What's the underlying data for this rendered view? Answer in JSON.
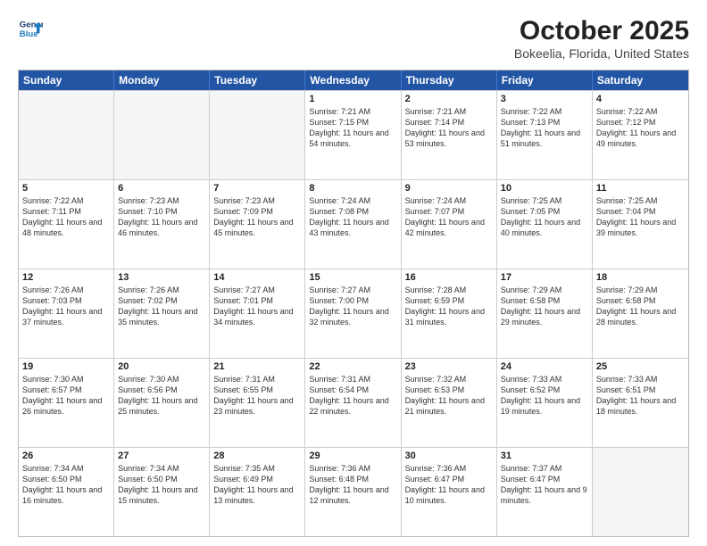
{
  "header": {
    "logo_line1": "General",
    "logo_line2": "Blue",
    "title": "October 2025",
    "subtitle": "Bokeelia, Florida, United States"
  },
  "weekdays": [
    "Sunday",
    "Monday",
    "Tuesday",
    "Wednesday",
    "Thursday",
    "Friday",
    "Saturday"
  ],
  "weeks": [
    [
      {
        "day": "",
        "empty": true
      },
      {
        "day": "",
        "empty": true
      },
      {
        "day": "",
        "empty": true
      },
      {
        "day": "1",
        "sunrise": "7:21 AM",
        "sunset": "7:15 PM",
        "daylight": "11 hours and 54 minutes."
      },
      {
        "day": "2",
        "sunrise": "7:21 AM",
        "sunset": "7:14 PM",
        "daylight": "11 hours and 53 minutes."
      },
      {
        "day": "3",
        "sunrise": "7:22 AM",
        "sunset": "7:13 PM",
        "daylight": "11 hours and 51 minutes."
      },
      {
        "day": "4",
        "sunrise": "7:22 AM",
        "sunset": "7:12 PM",
        "daylight": "11 hours and 49 minutes."
      }
    ],
    [
      {
        "day": "5",
        "sunrise": "7:22 AM",
        "sunset": "7:11 PM",
        "daylight": "11 hours and 48 minutes."
      },
      {
        "day": "6",
        "sunrise": "7:23 AM",
        "sunset": "7:10 PM",
        "daylight": "11 hours and 46 minutes."
      },
      {
        "day": "7",
        "sunrise": "7:23 AM",
        "sunset": "7:09 PM",
        "daylight": "11 hours and 45 minutes."
      },
      {
        "day": "8",
        "sunrise": "7:24 AM",
        "sunset": "7:08 PM",
        "daylight": "11 hours and 43 minutes."
      },
      {
        "day": "9",
        "sunrise": "7:24 AM",
        "sunset": "7:07 PM",
        "daylight": "11 hours and 42 minutes."
      },
      {
        "day": "10",
        "sunrise": "7:25 AM",
        "sunset": "7:05 PM",
        "daylight": "11 hours and 40 minutes."
      },
      {
        "day": "11",
        "sunrise": "7:25 AM",
        "sunset": "7:04 PM",
        "daylight": "11 hours and 39 minutes."
      }
    ],
    [
      {
        "day": "12",
        "sunrise": "7:26 AM",
        "sunset": "7:03 PM",
        "daylight": "11 hours and 37 minutes."
      },
      {
        "day": "13",
        "sunrise": "7:26 AM",
        "sunset": "7:02 PM",
        "daylight": "11 hours and 35 minutes."
      },
      {
        "day": "14",
        "sunrise": "7:27 AM",
        "sunset": "7:01 PM",
        "daylight": "11 hours and 34 minutes."
      },
      {
        "day": "15",
        "sunrise": "7:27 AM",
        "sunset": "7:00 PM",
        "daylight": "11 hours and 32 minutes."
      },
      {
        "day": "16",
        "sunrise": "7:28 AM",
        "sunset": "6:59 PM",
        "daylight": "11 hours and 31 minutes."
      },
      {
        "day": "17",
        "sunrise": "7:29 AM",
        "sunset": "6:58 PM",
        "daylight": "11 hours and 29 minutes."
      },
      {
        "day": "18",
        "sunrise": "7:29 AM",
        "sunset": "6:58 PM",
        "daylight": "11 hours and 28 minutes."
      }
    ],
    [
      {
        "day": "19",
        "sunrise": "7:30 AM",
        "sunset": "6:57 PM",
        "daylight": "11 hours and 26 minutes."
      },
      {
        "day": "20",
        "sunrise": "7:30 AM",
        "sunset": "6:56 PM",
        "daylight": "11 hours and 25 minutes."
      },
      {
        "day": "21",
        "sunrise": "7:31 AM",
        "sunset": "6:55 PM",
        "daylight": "11 hours and 23 minutes."
      },
      {
        "day": "22",
        "sunrise": "7:31 AM",
        "sunset": "6:54 PM",
        "daylight": "11 hours and 22 minutes."
      },
      {
        "day": "23",
        "sunrise": "7:32 AM",
        "sunset": "6:53 PM",
        "daylight": "11 hours and 21 minutes."
      },
      {
        "day": "24",
        "sunrise": "7:33 AM",
        "sunset": "6:52 PM",
        "daylight": "11 hours and 19 minutes."
      },
      {
        "day": "25",
        "sunrise": "7:33 AM",
        "sunset": "6:51 PM",
        "daylight": "11 hours and 18 minutes."
      }
    ],
    [
      {
        "day": "26",
        "sunrise": "7:34 AM",
        "sunset": "6:50 PM",
        "daylight": "11 hours and 16 minutes."
      },
      {
        "day": "27",
        "sunrise": "7:34 AM",
        "sunset": "6:50 PM",
        "daylight": "11 hours and 15 minutes."
      },
      {
        "day": "28",
        "sunrise": "7:35 AM",
        "sunset": "6:49 PM",
        "daylight": "11 hours and 13 minutes."
      },
      {
        "day": "29",
        "sunrise": "7:36 AM",
        "sunset": "6:48 PM",
        "daylight": "11 hours and 12 minutes."
      },
      {
        "day": "30",
        "sunrise": "7:36 AM",
        "sunset": "6:47 PM",
        "daylight": "11 hours and 10 minutes."
      },
      {
        "day": "31",
        "sunrise": "7:37 AM",
        "sunset": "6:47 PM",
        "daylight": "11 hours and 9 minutes."
      },
      {
        "day": "",
        "empty": true
      }
    ]
  ],
  "labels": {
    "sunrise_prefix": "Sunrise: ",
    "sunset_prefix": "Sunset: ",
    "daylight_prefix": "Daylight: "
  }
}
